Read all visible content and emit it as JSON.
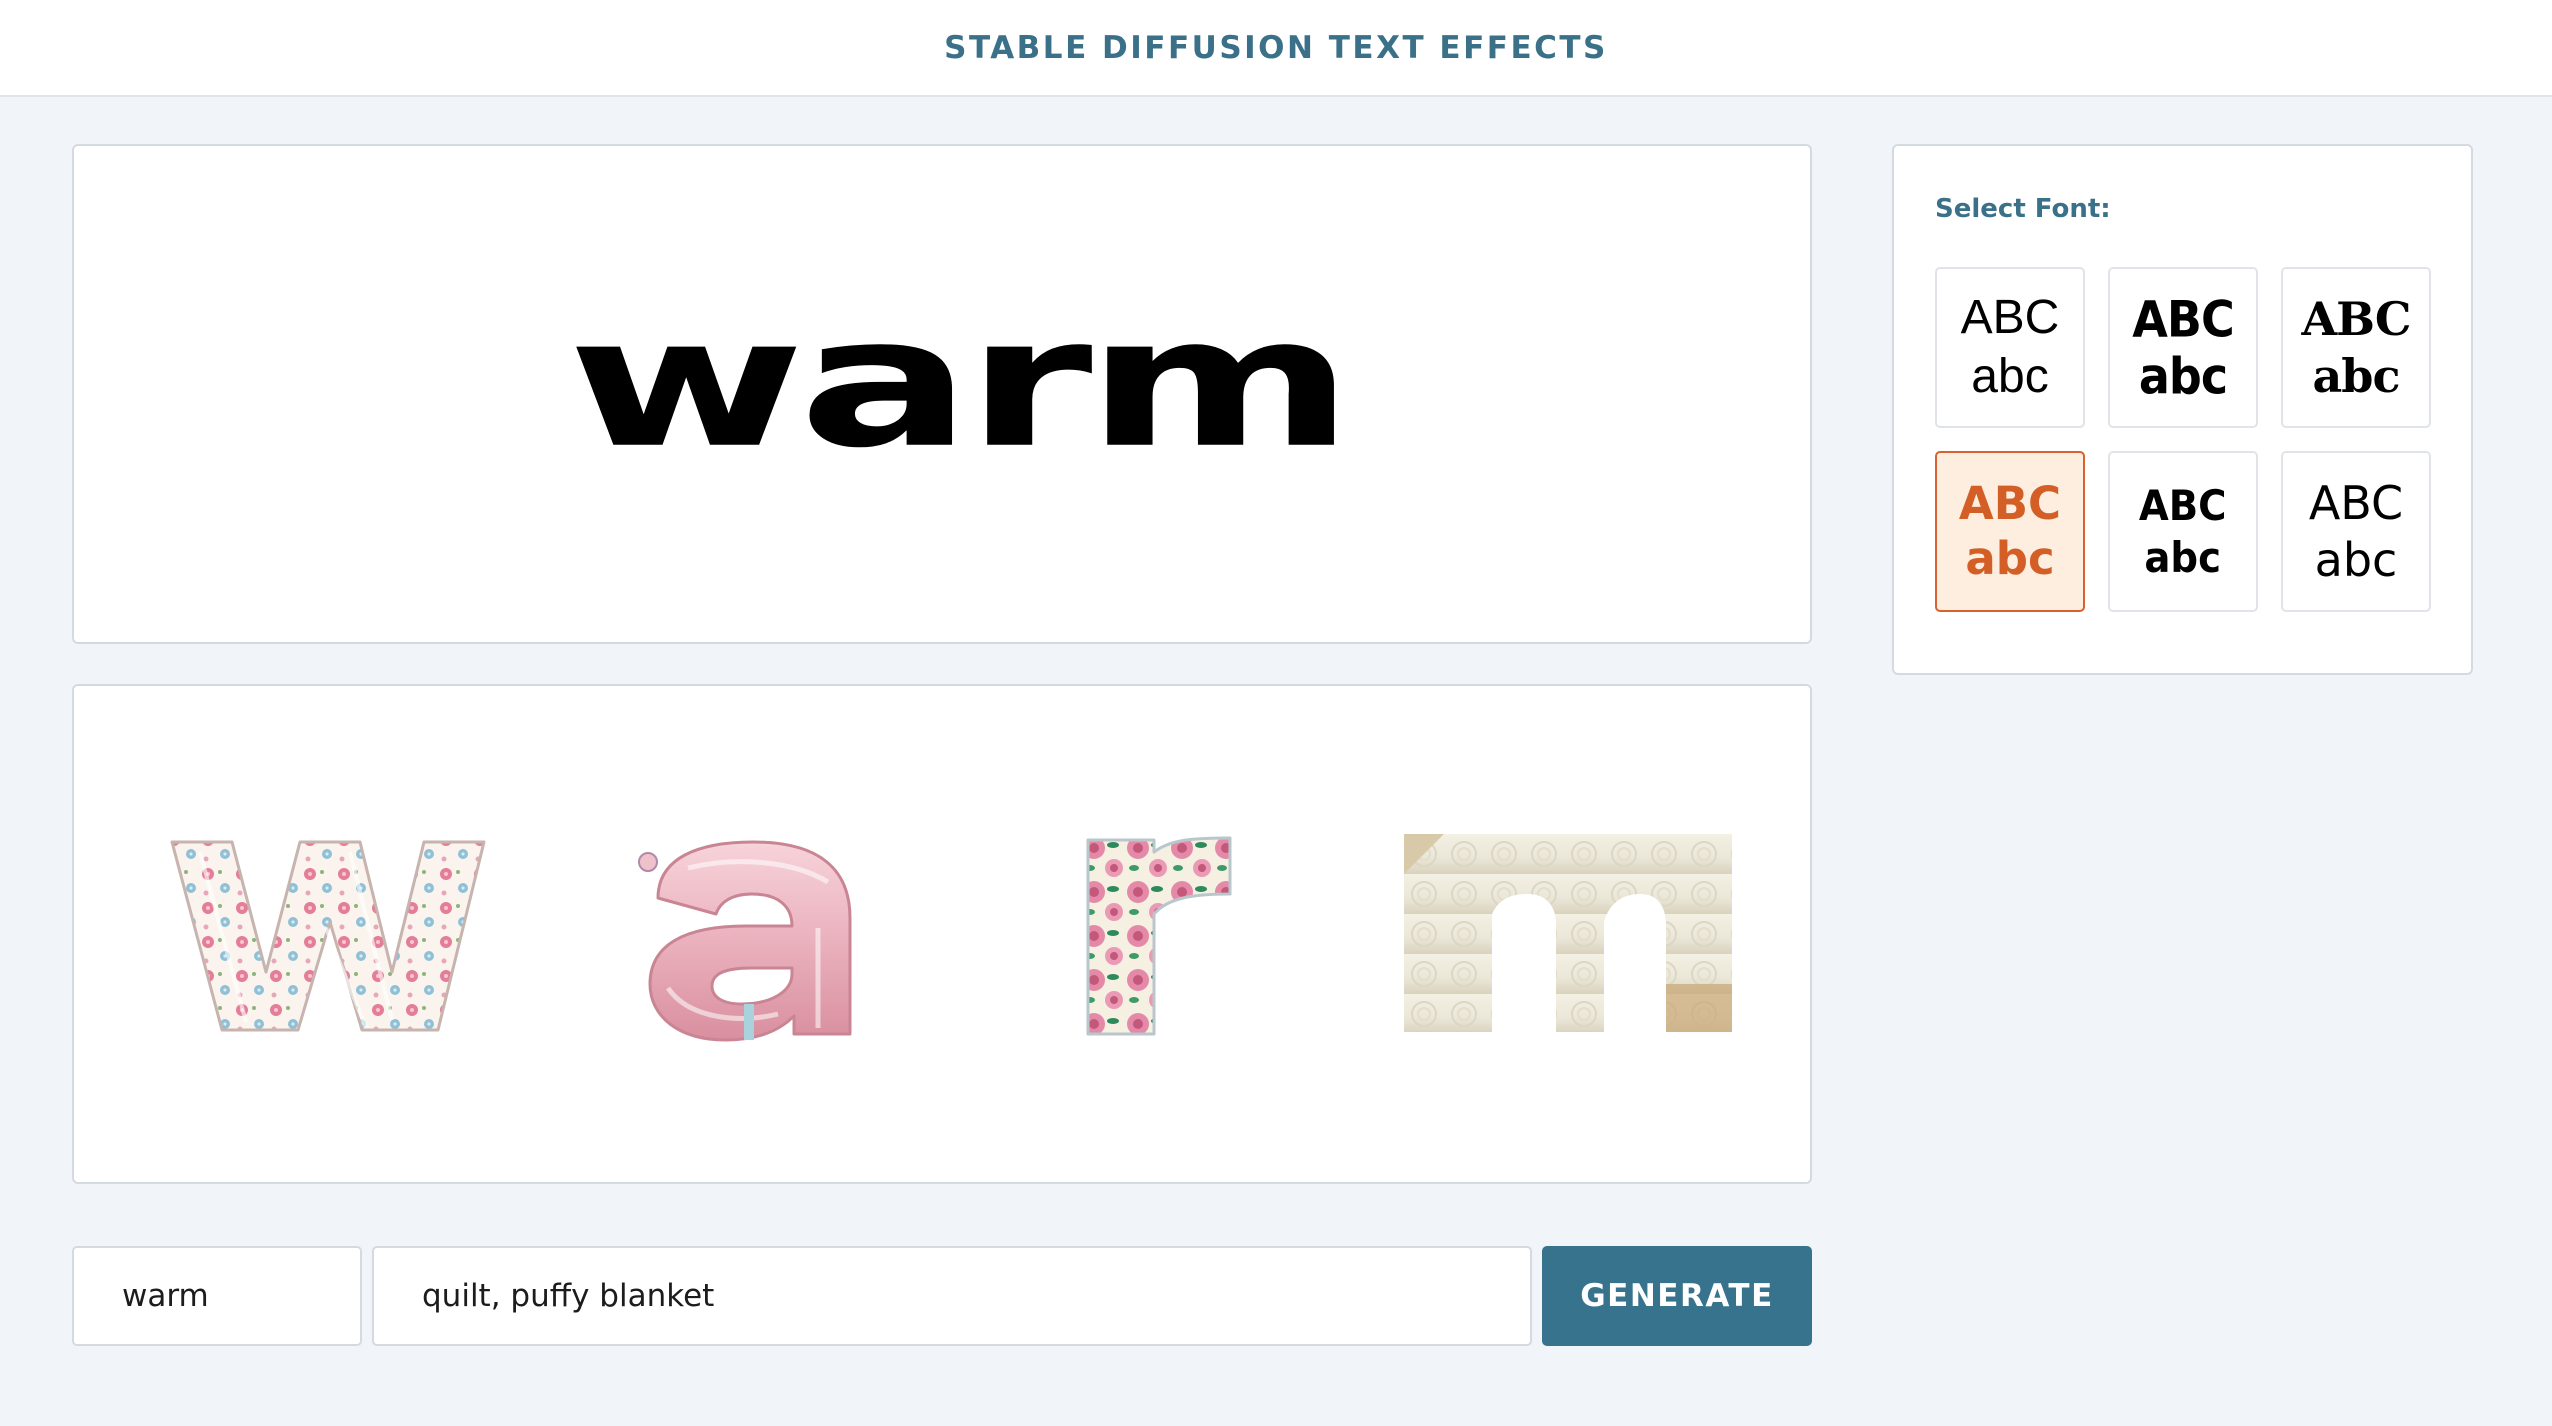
{
  "header": {
    "title": "STABLE DIFFUSION TEXT EFFECTS"
  },
  "preview": {
    "text": "warm"
  },
  "results": {
    "letters": [
      {
        "char": "w",
        "texture": "floral quilt"
      },
      {
        "char": "a",
        "texture": "pink puffy satin"
      },
      {
        "char": "r",
        "texture": "rose floral quilt"
      },
      {
        "char": "m",
        "texture": "white bed blanket"
      }
    ]
  },
  "font_panel": {
    "title": "Select Font:",
    "options": [
      {
        "upper": "ABC",
        "lower": "abc",
        "selected": false
      },
      {
        "upper": "ABC",
        "lower": "abc",
        "selected": false
      },
      {
        "upper": "ABC",
        "lower": "abc",
        "selected": false
      },
      {
        "upper": "ABC",
        "lower": "abc",
        "selected": true
      },
      {
        "upper": "ABC",
        "lower": "abc",
        "selected": false
      },
      {
        "upper": "ABC",
        "lower": "abc",
        "selected": false
      }
    ],
    "selected_color": "#d35f27"
  },
  "form": {
    "word_value": "warm",
    "prompt_value": "quilt, puffy blanket",
    "generate_label": "GENERATE"
  },
  "colors": {
    "accent": "#38738d",
    "title": "#3a7189",
    "background": "#f1f4f8"
  }
}
